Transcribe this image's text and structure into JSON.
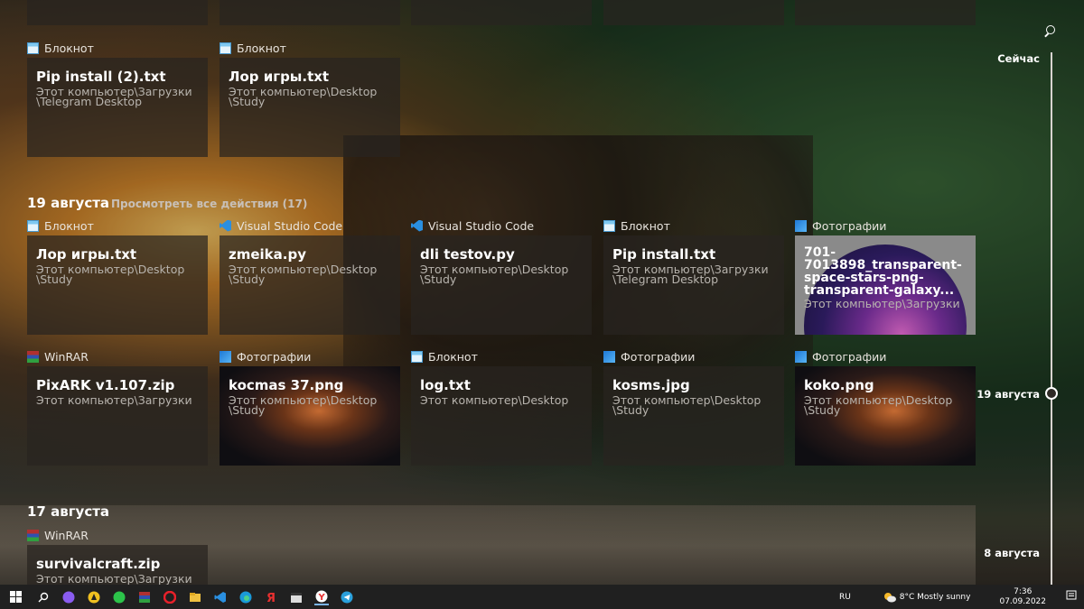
{
  "timeline": {
    "now_label": "Сейчас",
    "mid_label": "19 августа",
    "bottom_label": "8 августа"
  },
  "groups": {
    "earlier": {
      "cards": [
        {
          "app": "Блокнот",
          "icon": "notepad-icon",
          "title": "Pip install (2).txt",
          "path": "Этот компьютер\\Загрузки\n\\Telegram Desktop"
        },
        {
          "app": "Блокнот",
          "icon": "notepad-icon",
          "title": "Лор игры.txt",
          "path": "Этот компьютер\\Desktop\n\\Study"
        }
      ]
    },
    "aug19": {
      "date": "19 августа",
      "see_all": "Просмотреть все действия (17)",
      "row1": [
        {
          "app": "Блокнот",
          "title": "Лор игры.txt",
          "path": "Этот компьютер\\Desktop\n\\Study"
        },
        {
          "app": "Visual Studio Code",
          "title": "zmeika.py",
          "path": "Этот компьютер\\Desktop\n\\Study"
        },
        {
          "app": "Visual Studio Code",
          "title": "dli testov.py",
          "path": "Этот компьютер\\Desktop\n\\Study"
        },
        {
          "app": "Блокнот",
          "title": "Pip install.txt",
          "path": "Этот компьютер\\Загрузки\n\\Telegram Desktop"
        },
        {
          "app": "Фотографии",
          "title": "701-7013898_transparent-space-stars-png-transparent-galaxy...",
          "path": "Этот компьютер\\Загрузки"
        }
      ],
      "row2": [
        {
          "app": "WinRAR",
          "title": "PixARK v1.107.zip",
          "path": "Этот компьютер\\Загрузки"
        },
        {
          "app": "Фотографии",
          "title": "kocmas 37.png",
          "path": "Этот компьютер\\Desktop\n\\Study"
        },
        {
          "app": "Блокнот",
          "title": "log.txt",
          "path": "Этот компьютер\\Desktop"
        },
        {
          "app": "Фотографии",
          "title": "kosms.jpg",
          "path": "Этот компьютер\\Desktop\n\\Study"
        },
        {
          "app": "Фотографии",
          "title": "koko.png",
          "path": "Этот компьютер\\Desktop\n\\Study"
        }
      ]
    },
    "aug17": {
      "date": "17 августа",
      "cards": [
        {
          "app": "WinRAR",
          "title": "survivalcraft.zip",
          "path": "Этот компьютер\\Загрузки"
        }
      ]
    }
  },
  "taskbar": {
    "lang": "RU",
    "weather": "8°C  Mostly sunny",
    "time": "7:36",
    "date": "07.09.2022"
  }
}
